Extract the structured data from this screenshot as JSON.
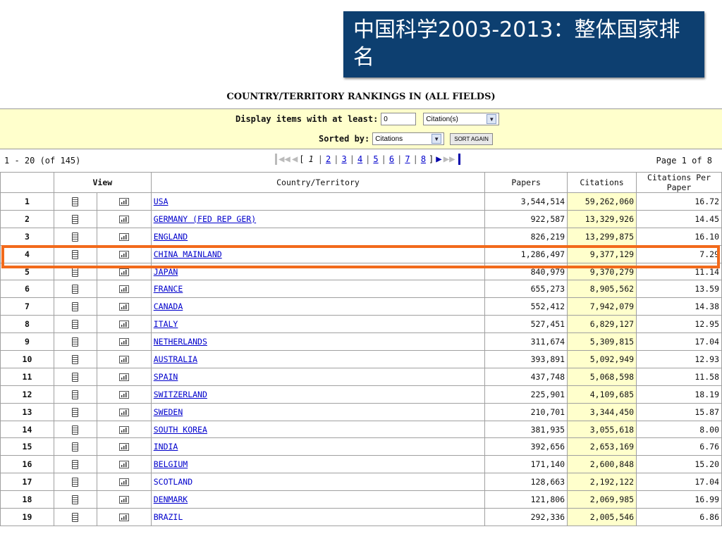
{
  "slide_title": "中国科学2003-2013：整体国家排名",
  "heading": "COUNTRY/TERRITORY RANKINGS IN (ALL FIELDS)",
  "filter": {
    "min_label": "Display items with at least:",
    "min_value": "0",
    "unit_selected": "Citation(s)",
    "sort_label": "Sorted by:",
    "sort_selected": "Citations",
    "sort_button": "SORT AGAIN"
  },
  "nav": {
    "range": "1 - 20 (of 145)",
    "current": "1",
    "pages": [
      "2",
      "3",
      "4",
      "5",
      "6",
      "7",
      "8"
    ],
    "page_of": "Page 1 of 8"
  },
  "columns": {
    "view": "View",
    "country": "Country/Territory",
    "papers": "Papers",
    "citations": "Citations",
    "cpp": "Citations Per Paper"
  },
  "rows": [
    {
      "rank": "1",
      "country": "USA",
      "papers": "3,544,514",
      "citations": "59,262,060",
      "cpp": "16.72"
    },
    {
      "rank": "2",
      "country": "GERMANY (FED REP GER)",
      "papers": "922,587",
      "citations": "13,329,926",
      "cpp": "14.45"
    },
    {
      "rank": "3",
      "country": "ENGLAND",
      "papers": "826,219",
      "citations": "13,299,875",
      "cpp": "16.10"
    },
    {
      "rank": "4",
      "country": "CHINA MAINLAND",
      "papers": "1,286,497",
      "citations": "9,377,129",
      "cpp": "7.29"
    },
    {
      "rank": "5",
      "country": "JAPAN",
      "papers": "840,979",
      "citations": "9,370,279",
      "cpp": "11.14"
    },
    {
      "rank": "6",
      "country": "FRANCE",
      "papers": "655,273",
      "citations": "8,905,562",
      "cpp": "13.59"
    },
    {
      "rank": "7",
      "country": "CANADA",
      "papers": "552,412",
      "citations": "7,942,079",
      "cpp": "14.38"
    },
    {
      "rank": "8",
      "country": "ITALY",
      "papers": "527,451",
      "citations": "6,829,127",
      "cpp": "12.95"
    },
    {
      "rank": "9",
      "country": "NETHERLANDS",
      "papers": "311,674",
      "citations": "5,309,815",
      "cpp": "17.04"
    },
    {
      "rank": "10",
      "country": "AUSTRALIA",
      "papers": "393,891",
      "citations": "5,092,949",
      "cpp": "12.93"
    },
    {
      "rank": "11",
      "country": "SPAIN",
      "papers": "437,748",
      "citations": "5,068,598",
      "cpp": "11.58"
    },
    {
      "rank": "12",
      "country": "SWITZERLAND",
      "papers": "225,901",
      "citations": "4,109,685",
      "cpp": "18.19"
    },
    {
      "rank": "13",
      "country": "SWEDEN",
      "papers": "210,701",
      "citations": "3,344,450",
      "cpp": "15.87"
    },
    {
      "rank": "14",
      "country": "SOUTH KOREA",
      "papers": "381,935",
      "citations": "3,055,618",
      "cpp": "8.00"
    },
    {
      "rank": "15",
      "country": "INDIA",
      "papers": "392,656",
      "citations": "2,653,169",
      "cpp": "6.76"
    },
    {
      "rank": "16",
      "country": "BELGIUM",
      "papers": "171,140",
      "citations": "2,600,848",
      "cpp": "15.20"
    },
    {
      "rank": "17",
      "country": "SCOTLAND",
      "papers": "128,663",
      "citations": "2,192,122",
      "cpp": "17.04"
    },
    {
      "rank": "18",
      "country": "DENMARK",
      "papers": "121,806",
      "citations": "2,069,985",
      "cpp": "16.99"
    },
    {
      "rank": "19",
      "country": "BRAZIL",
      "papers": "292,336",
      "citations": "2,005,546",
      "cpp": "6.86"
    }
  ],
  "colors": {
    "title_bg": "#0d3f70",
    "filter_bg": "#ffffcc",
    "highlight": "#f26a1b",
    "link": "#0000cc"
  }
}
